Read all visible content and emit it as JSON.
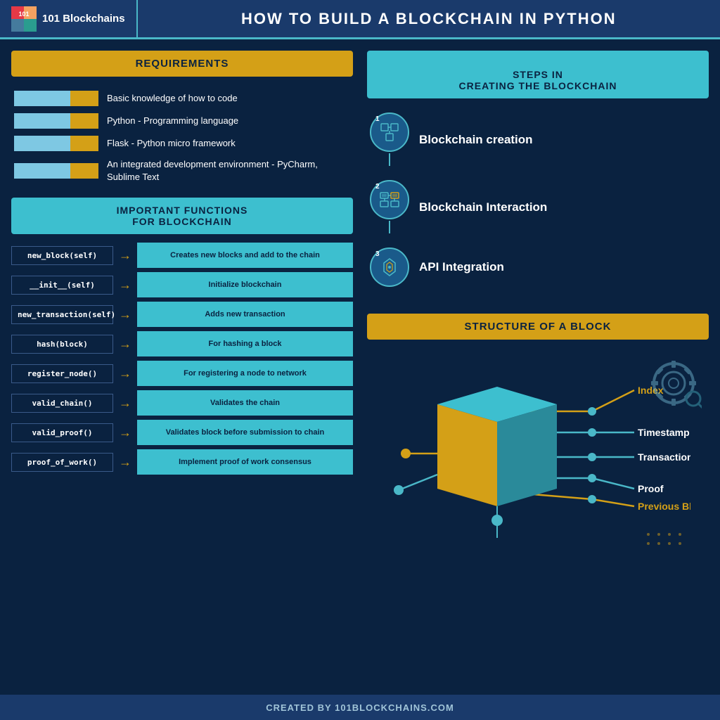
{
  "header": {
    "logo_text": "101 Blockchains",
    "title": "HOW TO BUILD A BLOCKCHAIN IN PYTHON"
  },
  "requirements": {
    "section_title": "REQUIREMENTS",
    "items": [
      {
        "text": "Basic knowledge of how to code"
      },
      {
        "text": "Python - Programming language"
      },
      {
        "text": "Flask - Python micro framework"
      },
      {
        "text": "An integrated development environment - PyCharm, Sublime Text"
      }
    ]
  },
  "steps": {
    "section_title": "STEPS IN\nCREATING THE BLOCKCHAIN",
    "items": [
      {
        "number": "1",
        "label": "Blockchain creation"
      },
      {
        "number": "2",
        "label": "Blockchain Interaction"
      },
      {
        "number": "3",
        "label": "API Integration"
      }
    ]
  },
  "functions": {
    "section_title": "IMPORTANT FUNCTIONS\nFOR BLOCKCHAIN",
    "items": [
      {
        "name": "new_block(self)",
        "desc": "Creates new blocks and add to the chain"
      },
      {
        "name": "__init__(self)",
        "desc": "Initialize blockchain"
      },
      {
        "name": "new_transaction(self)",
        "desc": "Adds new transaction"
      },
      {
        "name": "hash(block)",
        "desc": "For hashing a block"
      },
      {
        "name": "register_node()",
        "desc": "For registering a node to network"
      },
      {
        "name": "valid_chain()",
        "desc": "Validates the chain"
      },
      {
        "name": "valid_proof()",
        "desc": "Validates block before submission to chain"
      },
      {
        "name": "proof_of_work()",
        "desc": "Implement proof of work consensus"
      }
    ]
  },
  "block_structure": {
    "section_title": "STRUCTURE OF A BLOCK",
    "labels": [
      {
        "text": "Index",
        "color": "#d4a017"
      },
      {
        "text": "Timestamp In Unix Time",
        "color": "#4ab8c8"
      },
      {
        "text": "Transactions List",
        "color": "#4ab8c8"
      },
      {
        "text": "Proof",
        "color": "#4ab8c8"
      },
      {
        "text": "Previous Block Hash",
        "color": "#d4a017"
      }
    ]
  },
  "footer": {
    "text": "CREATED BY 101BLOCKCHAINS.COM"
  }
}
